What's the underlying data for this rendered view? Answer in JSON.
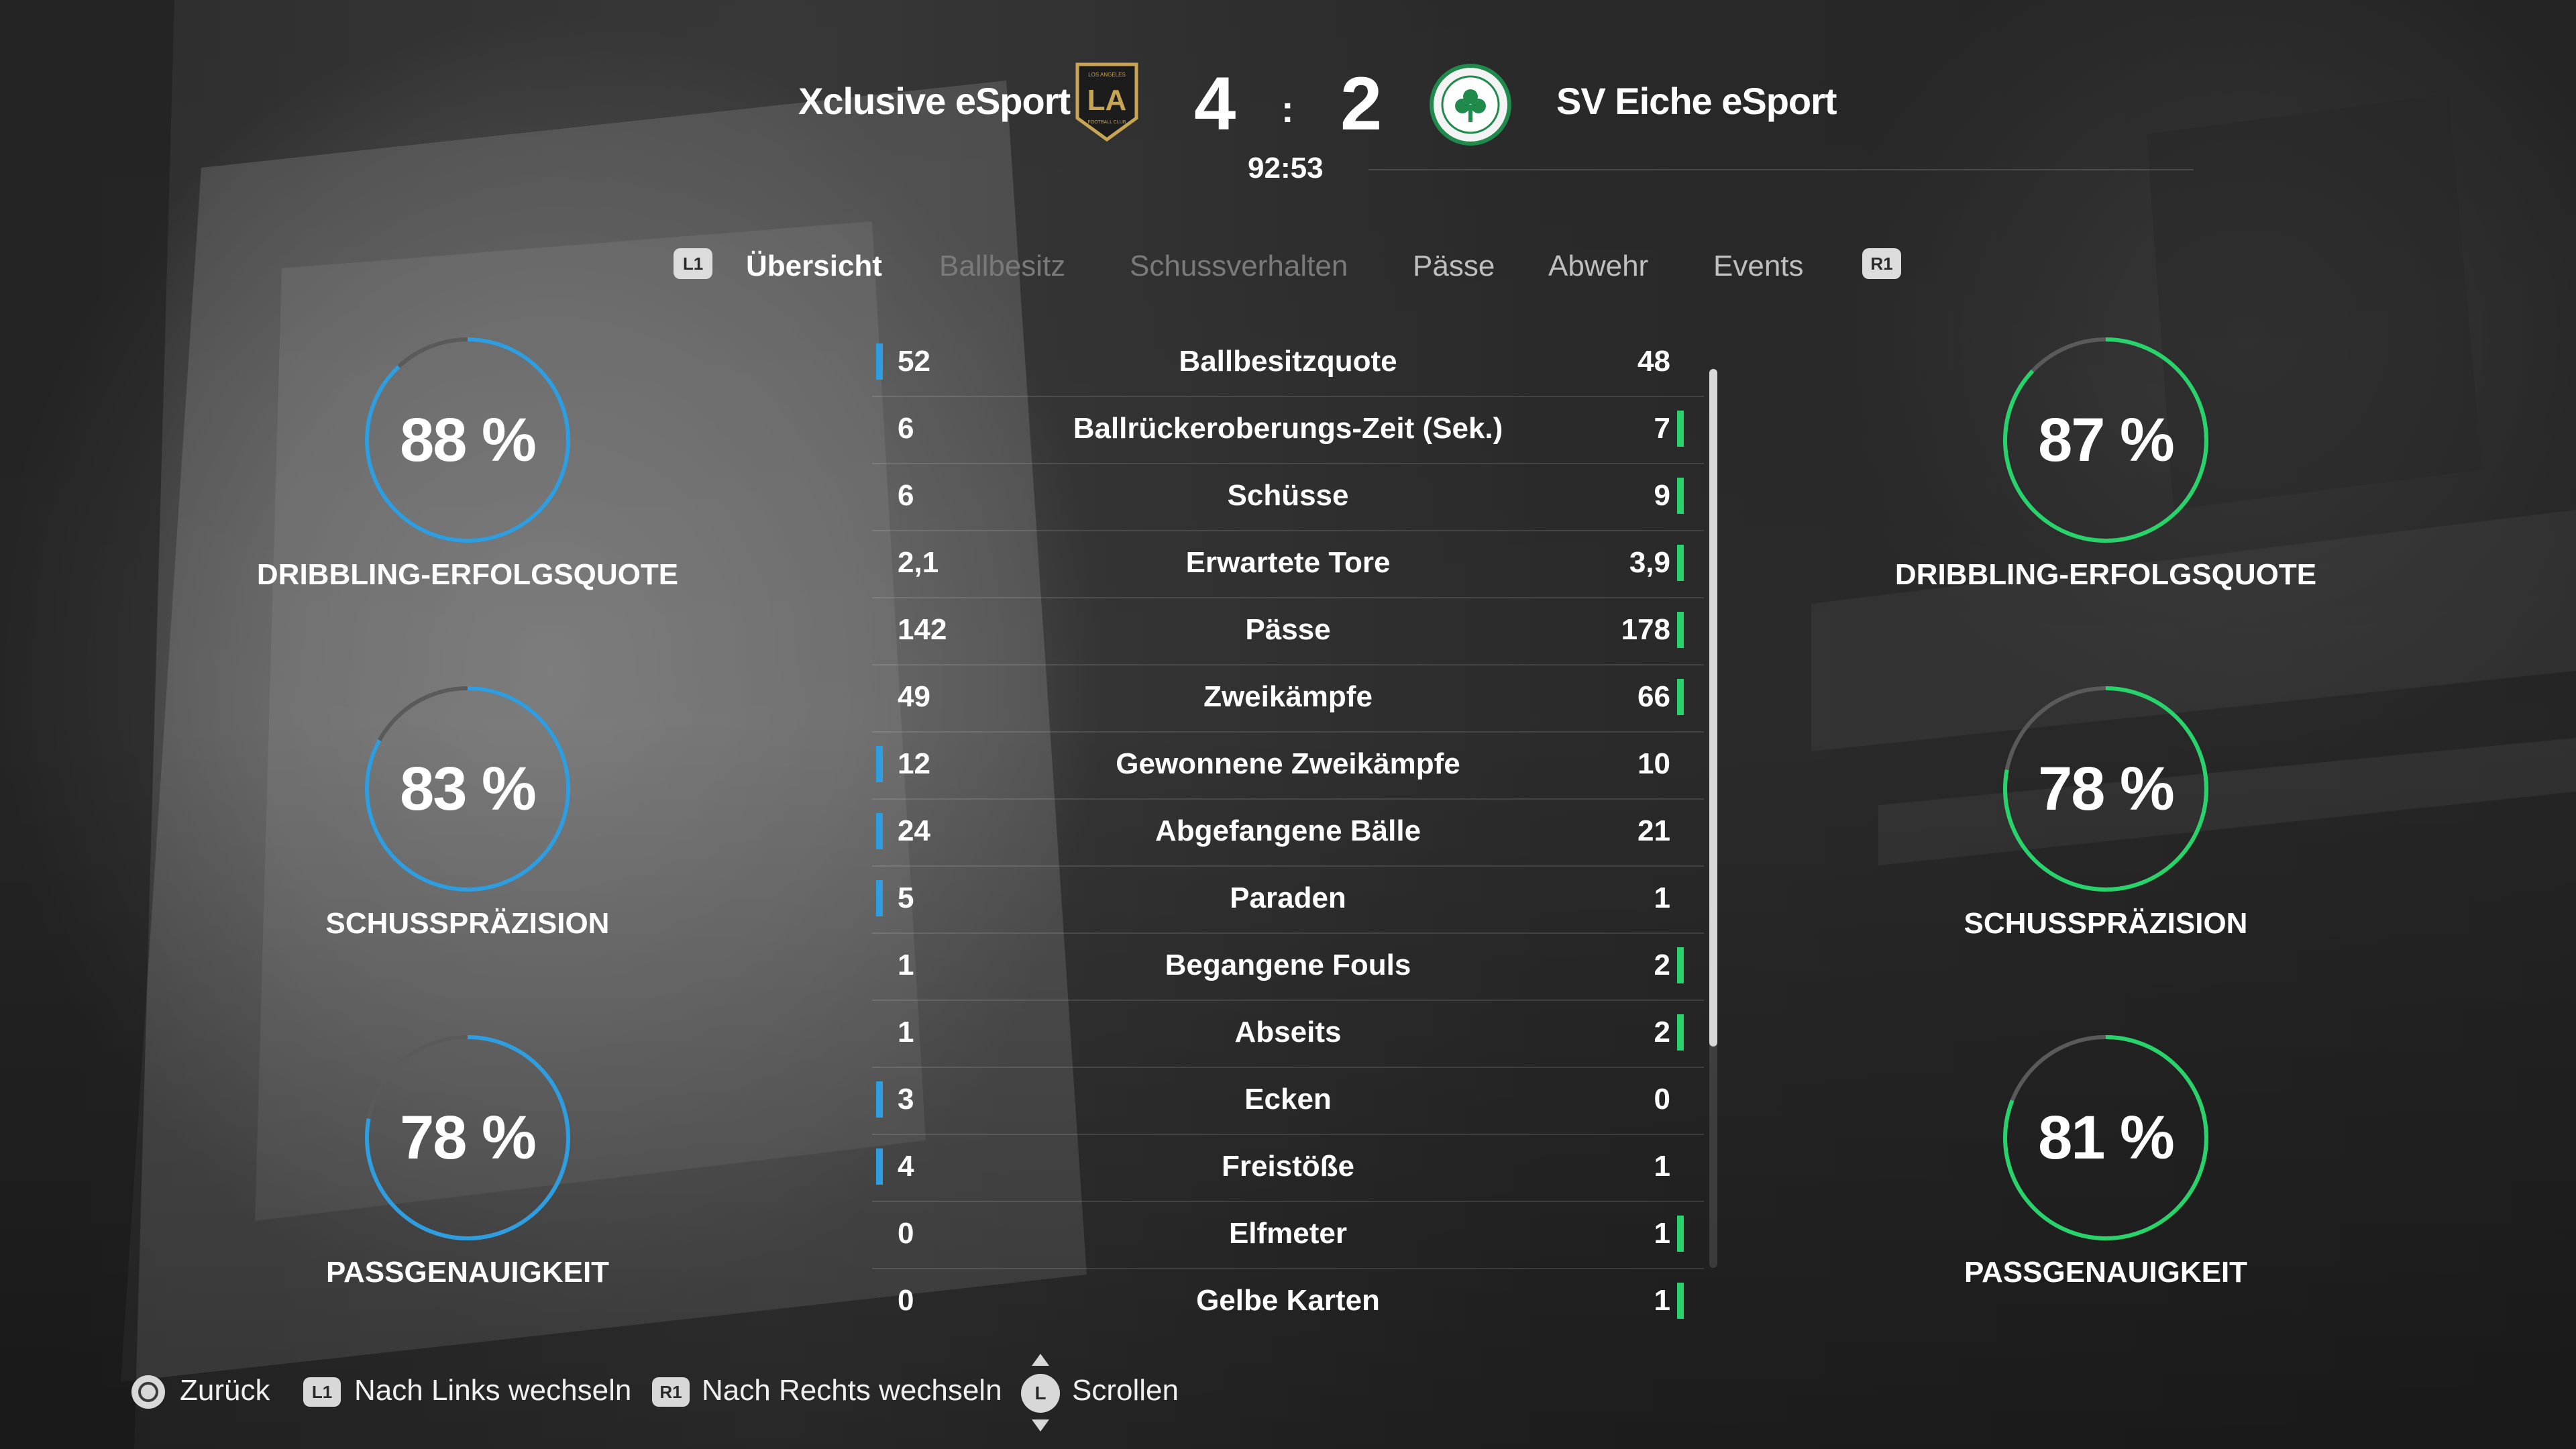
{
  "header": {
    "home_team": "Xclusive eSport",
    "away_team": "SV Eiche eSport",
    "home_score": "4",
    "separator": ":",
    "away_score": "2",
    "clock": "92:53",
    "home_crest": "LAFC crest (LOS ANGELES FOOTBALL CLUB)",
    "away_crest": "Celtic crest (THE CELTIC FOOTBALL CLUB)"
  },
  "tabs": {
    "left_button": "L1",
    "right_button": "R1",
    "items": [
      {
        "label": "Übersicht",
        "state": "active"
      },
      {
        "label": "Ballbesitz",
        "state": "disabled"
      },
      {
        "label": "Schussverhalten",
        "state": "disabled"
      },
      {
        "label": "Pässe",
        "state": "inactive"
      },
      {
        "label": "Abwehr",
        "state": "inactive"
      },
      {
        "label": "Events",
        "state": "inactive"
      }
    ]
  },
  "home_rings": [
    {
      "value": "88 %",
      "label": "DRIBBLING-ERFOLGSQUOTE",
      "percent": 88
    },
    {
      "value": "83 %",
      "label": "SCHUSSPRÄZISION",
      "percent": 83
    },
    {
      "value": "78 %",
      "label": "PASSGENAUIGKEIT",
      "percent": 78
    }
  ],
  "away_rings": [
    {
      "value": "87 %",
      "label": "DRIBBLING-ERFOLGSQUOTE",
      "percent": 87
    },
    {
      "value": "78 %",
      "label": "SCHUSSPRÄZISION",
      "percent": 78
    },
    {
      "value": "81 %",
      "label": "PASSGENAUIGKEIT",
      "percent": 81
    }
  ],
  "stats": [
    {
      "home": "52",
      "name": "Ballbesitzquote",
      "away": "48",
      "leader": "home"
    },
    {
      "home": "6",
      "name": "Ballrückeroberungs-Zeit (Sek.)",
      "away": "7",
      "leader": "away"
    },
    {
      "home": "6",
      "name": "Schüsse",
      "away": "9",
      "leader": "away"
    },
    {
      "home": "2,1",
      "name": "Erwartete Tore",
      "away": "3,9",
      "leader": "away"
    },
    {
      "home": "142",
      "name": "Pässe",
      "away": "178",
      "leader": "away"
    },
    {
      "home": "49",
      "name": "Zweikämpfe",
      "away": "66",
      "leader": "away"
    },
    {
      "home": "12",
      "name": "Gewonnene Zweikämpfe",
      "away": "10",
      "leader": "home"
    },
    {
      "home": "24",
      "name": "Abgefangene Bälle",
      "away": "21",
      "leader": "home"
    },
    {
      "home": "5",
      "name": "Paraden",
      "away": "1",
      "leader": "home"
    },
    {
      "home": "1",
      "name": "Begangene Fouls",
      "away": "2",
      "leader": "away"
    },
    {
      "home": "1",
      "name": "Abseits",
      "away": "2",
      "leader": "away"
    },
    {
      "home": "3",
      "name": "Ecken",
      "away": "0",
      "leader": "home"
    },
    {
      "home": "4",
      "name": "Freistöße",
      "away": "1",
      "leader": "home"
    },
    {
      "home": "0",
      "name": "Elfmeter",
      "away": "1",
      "leader": "away"
    },
    {
      "home": "0",
      "name": "Gelbe Karten",
      "away": "1",
      "leader": "away"
    }
  ],
  "footer": {
    "back": "Zurück",
    "left_button": "L1",
    "switch_left": "Nach Links wechseln",
    "right_button": "R1",
    "switch_right": "Nach Rechts wechseln",
    "stick": "L",
    "scroll": "Scrollen"
  },
  "colors": {
    "home_accent": "#2f9ee0",
    "away_accent": "#27d36a",
    "ring_track": "#5a5a5a"
  },
  "scroll_position": 0.0
}
